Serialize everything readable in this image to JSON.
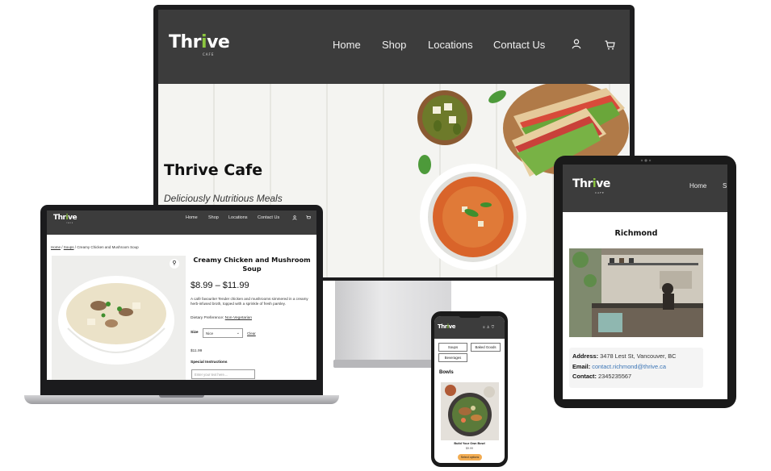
{
  "desktop": {
    "logo": {
      "pre": "Thr",
      "accent": "i",
      "post": "ve",
      "sub": "CAFE"
    },
    "nav": [
      "Home",
      "Shop",
      "Locations",
      "Contact Us"
    ],
    "icons": [
      "user-icon",
      "cart-icon"
    ],
    "hero_title": "Thrive Cafe",
    "hero_subtitle": "Deliciously Nutritious Meals"
  },
  "laptop": {
    "logo": {
      "pre": "Thr",
      "accent": "i",
      "post": "ve",
      "sub": "CAFE"
    },
    "nav": [
      "Home",
      "Shop",
      "Locations",
      "Contact Us"
    ],
    "breadcrumb": {
      "home": "Home",
      "soups": "Soups",
      "current": "Creamy Chicken and Mushroom Soup"
    },
    "product_title": "Creamy Chicken and Mushroom Soup",
    "price_range": "$8.99 – $11.99",
    "description": "A café favourite! Tender chicken and mushrooms simmered in a creamy herb-infused broth, topped with a sprinkle of fresh parsley.",
    "dietary_label": "Dietary Preference:",
    "dietary_value": "Non-Vegetarian",
    "size_label": "Size",
    "size_value": "Nice",
    "clear_label": "Clear",
    "selected_price": "$11.99",
    "special_label": "Special Instructions",
    "special_placeholder": "Enter your text here....",
    "icons": [
      "user-icon",
      "cart-icon",
      "zoom-icon"
    ]
  },
  "tablet": {
    "logo": {
      "pre": "Thr",
      "accent": "i",
      "post": "ve",
      "sub": "CAFE"
    },
    "nav_home": "Home",
    "nav_partial": "S",
    "city": "Richmond",
    "address_label": "Address:",
    "address_value": "3478 Lest St, Vancouver, BC",
    "email_label": "Email:",
    "email_value": "contact.richmond@thrive.ca",
    "contact_label": "Contact:",
    "contact_value": "2345235567"
  },
  "phone": {
    "logo": {
      "pre": "Thr",
      "accent": "i",
      "post": "ve"
    },
    "chips": [
      "Soups",
      "Baked Goods",
      "Beverages"
    ],
    "section": "Bowls",
    "item_name": "Build Your Own Bowl",
    "item_price": "$9.99",
    "button": "Select options",
    "icons": [
      "menu-icon",
      "user-icon",
      "cart-icon"
    ]
  },
  "colors": {
    "header": "#3c3c3c",
    "accent_green": "#8cc63f",
    "button_orange": "#f2ac52",
    "link_blue": "#3a74b5"
  }
}
